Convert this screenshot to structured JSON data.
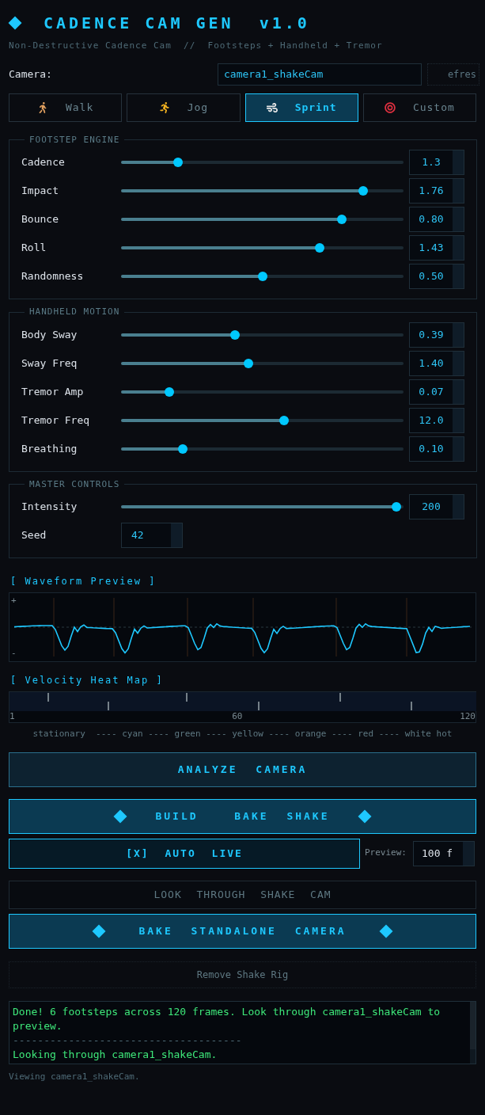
{
  "header": {
    "title": "CADENCE CAM GEN  v1.0",
    "subtitle": "Non-Destructive Cadence Cam  //  Footsteps + Handheld + Tremor"
  },
  "camera": {
    "label": "Camera:",
    "value": "camera1_shakeCam",
    "refresh": "efres"
  },
  "presets": [
    {
      "label": "Walk",
      "kind": "walk",
      "selected": false
    },
    {
      "label": "Jog",
      "kind": "jog",
      "selected": false
    },
    {
      "label": "Sprint",
      "kind": "sprint",
      "selected": true
    },
    {
      "label": "Custom",
      "kind": "custom",
      "selected": false
    }
  ],
  "sections": [
    {
      "title": "FOOTSTEP ENGINE",
      "sliders": [
        {
          "name": "Cadence",
          "level": 0.19,
          "value": "1.3"
        },
        {
          "name": "Impact",
          "level": 0.87,
          "value": "1.76"
        },
        {
          "name": "Bounce",
          "level": 0.79,
          "value": "0.80"
        },
        {
          "name": "Roll",
          "level": 0.71,
          "value": "1.43"
        },
        {
          "name": "Randomness",
          "level": 0.5,
          "value": "0.50"
        }
      ]
    },
    {
      "title": "HANDHELD MOTION",
      "sliders": [
        {
          "name": "Body Sway",
          "level": 0.4,
          "value": "0.39"
        },
        {
          "name": "Sway Freq",
          "level": 0.45,
          "value": "1.40"
        },
        {
          "name": "Tremor Amp",
          "level": 0.16,
          "value": "0.07"
        },
        {
          "name": "Tremor Freq",
          "level": 0.58,
          "value": "12.0"
        },
        {
          "name": "Breathing",
          "level": 0.21,
          "value": "0.10"
        }
      ]
    },
    {
      "title": "MASTER CONTROLS",
      "sliders": [
        {
          "name": "Intensity",
          "level": 0.99,
          "value": "200"
        }
      ],
      "seed": {
        "label": "Seed",
        "value": "42"
      }
    }
  ],
  "waveform": {
    "title": "[ Waveform Preview ]",
    "plus": "+",
    "minus": "-"
  },
  "heatmap": {
    "title": "[ Velocity Heat Map ]",
    "axis": [
      "1",
      "60",
      "120"
    ],
    "legend": "stationary  ---- cyan ---- green ---- yellow ---- orange ---- red ---- white hot"
  },
  "actions": {
    "analyze": "ANALYZE CAMERA",
    "build": "BUILD  BAKE SHAKE",
    "auto_live": "[X] AUTO LIVE",
    "preview_label": "Preview:",
    "preview_value": "100 f",
    "look_through": "LOOK THROUGH SHAKE CAM",
    "bake_standalone": "BAKE STANDALONE CAMERA",
    "remove": "Remove Shake Rig"
  },
  "log": [
    {
      "kind": "success",
      "text": "Done! 6 footsteps across 120 frames. Look through camera1_shakeCam to preview."
    },
    {
      "kind": "separator",
      "text": "-------------------------------------"
    },
    {
      "kind": "success",
      "text": "Looking through camera1_shakeCam."
    }
  ],
  "status": "Viewing camera1_shakeCam."
}
